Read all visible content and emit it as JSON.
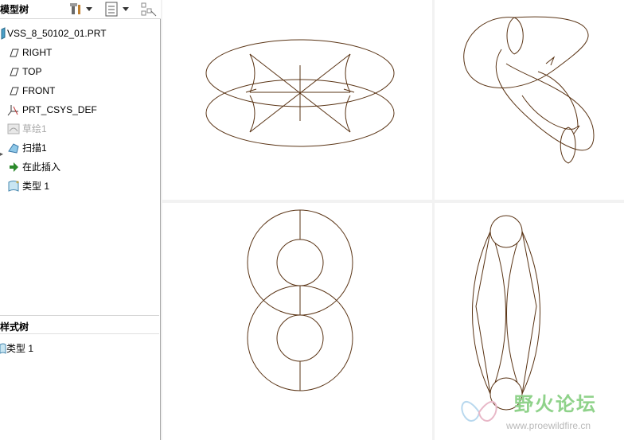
{
  "model_tree": {
    "title": "模型树",
    "items": [
      {
        "label": "VSS_8_50102_01.PRT",
        "icon": "part-icon",
        "disabled": false
      },
      {
        "label": "RIGHT",
        "icon": "datum-plane-icon",
        "disabled": false
      },
      {
        "label": "TOP",
        "icon": "datum-plane-icon",
        "disabled": false
      },
      {
        "label": "FRONT",
        "icon": "datum-plane-icon",
        "disabled": false
      },
      {
        "label": "PRT_CSYS_DEF",
        "icon": "csys-icon",
        "disabled": false
      },
      {
        "label": "草绘1",
        "icon": "sketch-icon",
        "disabled": true
      },
      {
        "label": "扫描1",
        "icon": "sweep-icon",
        "disabled": false
      },
      {
        "label": "在此插入",
        "icon": "insert-here-arrow-icon",
        "disabled": false
      },
      {
        "label": "类型 1",
        "icon": "style-type-icon",
        "disabled": false
      }
    ]
  },
  "style_tree": {
    "title": "样式树",
    "items": [
      {
        "label": "类型 1",
        "icon": "style-type-icon"
      }
    ]
  },
  "watermark": {
    "logo_text": "野火论坛",
    "url": "www.proewildfire.cn"
  },
  "colors": {
    "wireframe": "#5a3415",
    "viewport_bg": "#ffffff",
    "divider": "#c8c8c8",
    "watermark_green": "#8fd28a"
  }
}
